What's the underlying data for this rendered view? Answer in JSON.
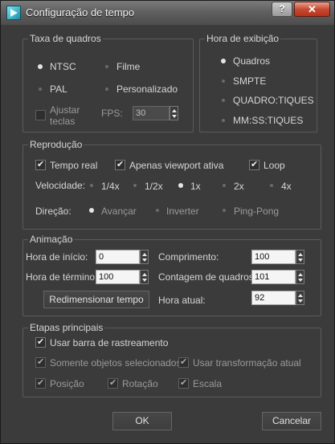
{
  "window": {
    "title": "Configuração de tempo",
    "help_label": "?",
    "close_label": "✕"
  },
  "frame_rate": {
    "title": "Taxa de quadros",
    "options": [
      {
        "label": "NTSC",
        "selected": true
      },
      {
        "label": "Filme",
        "selected": false
      },
      {
        "label": "PAL",
        "selected": false
      },
      {
        "label": "Personalizado",
        "selected": false
      }
    ],
    "adjust_keys_label_1": "Ajustar",
    "adjust_keys_label_2": "teclas",
    "adjust_keys_checked": false,
    "fps_label": "FPS:",
    "fps_value": "30"
  },
  "time_display": {
    "title": "Hora de exibição",
    "options": [
      {
        "label": "Quadros",
        "selected": true
      },
      {
        "label": "SMPTE",
        "selected": false
      },
      {
        "label": "QUADRO:TIQUES",
        "selected": false
      },
      {
        "label": "MM:SS:TIQUES",
        "selected": false
      }
    ]
  },
  "playback": {
    "title": "Reprodução",
    "real_time_label": "Tempo real",
    "active_viewport_label": "Apenas viewport ativa",
    "loop_label": "Loop",
    "speed_label": "Velocidade:",
    "speeds": [
      {
        "label": "1/4x",
        "selected": false
      },
      {
        "label": "1/2x",
        "selected": false
      },
      {
        "label": "1x",
        "selected": true
      },
      {
        "label": "2x",
        "selected": false
      },
      {
        "label": "4x",
        "selected": false
      }
    ],
    "direction_label": "Direção:",
    "directions": [
      {
        "label": "Avançar",
        "selected": true
      },
      {
        "label": "Inverter",
        "selected": false
      },
      {
        "label": "Ping-Pong",
        "selected": false
      }
    ]
  },
  "animation": {
    "title": "Animação",
    "start_label": "Hora de início:",
    "start_value": "0",
    "length_label": "Comprimento:",
    "length_value": "100",
    "end_label": "Hora de término:",
    "end_value": "100",
    "frame_count_label": "Contagem de quadros:",
    "frame_count_value": "101",
    "rescale_button": "Redimensionar tempo",
    "current_label": "Hora atual:",
    "current_value": "92"
  },
  "key_steps": {
    "title": "Etapas principais",
    "use_trackbar_label": "Usar barra de rastreamento",
    "selected_only_label": "Somente objetos selecionados",
    "use_current_transform_label": "Usar transformação atual",
    "position_label": "Posição",
    "rotation_label": "Rotação",
    "scale_label": "Escala"
  },
  "footer": {
    "ok_label": "OK",
    "cancel_label": "Cancelar"
  }
}
